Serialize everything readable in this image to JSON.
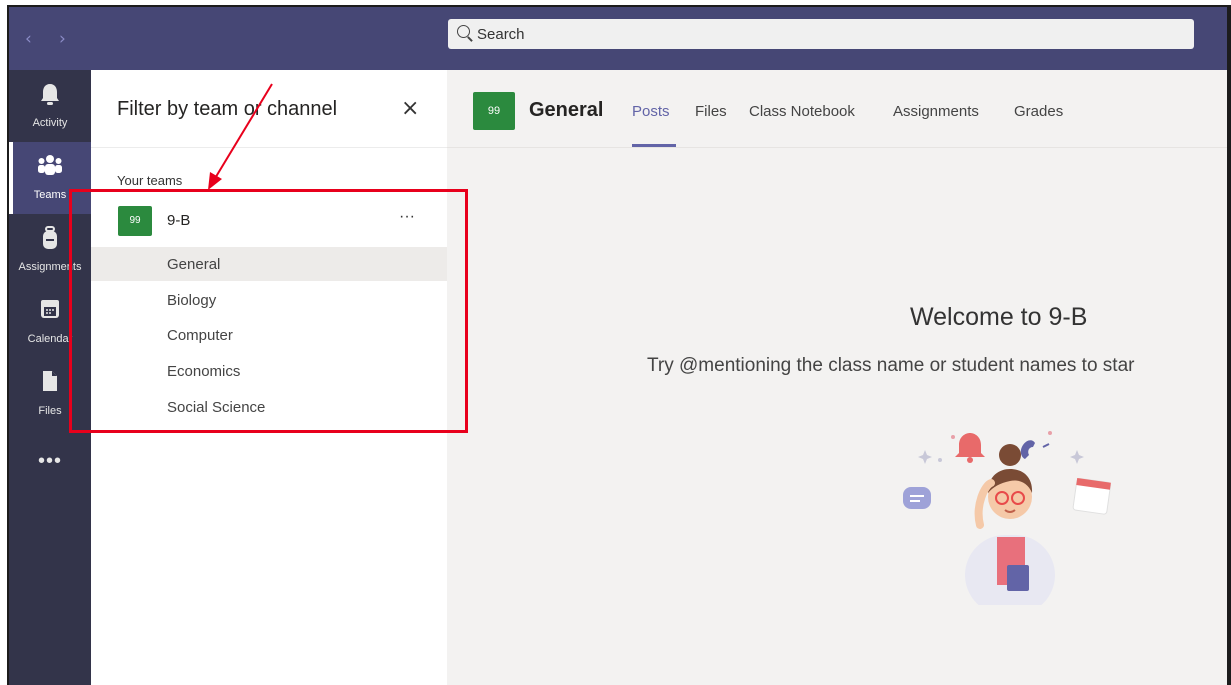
{
  "topbar": {
    "back_glyph": "‹",
    "forward_glyph": "›",
    "search_placeholder": "Search"
  },
  "rail": {
    "items": [
      {
        "label": "Activity",
        "icon": "bell-icon"
      },
      {
        "label": "Teams",
        "icon": "people-icon",
        "active": true
      },
      {
        "label": "Assignments",
        "icon": "backpack-icon"
      },
      {
        "label": "Calendar",
        "icon": "calendar-icon"
      },
      {
        "label": "Files",
        "icon": "file-icon"
      }
    ],
    "more": "•••"
  },
  "panel": {
    "filter_title": "Filter by team or channel",
    "close_glyph": "×",
    "section_label": "Your teams",
    "team": {
      "avatar": "99",
      "name": "9-B",
      "more": "···"
    },
    "channels": [
      "General",
      "Biology",
      "Computer",
      "Economics",
      "Social Science"
    ],
    "selected_channel": "General"
  },
  "main": {
    "avatar": "99",
    "channel_title": "General",
    "tabs": [
      "Posts",
      "Files",
      "Class Notebook",
      "Assignments",
      "Grades"
    ],
    "active_tab": "Posts",
    "welcome_title": "Welcome to 9-B",
    "welcome_sub": "Try @mentioning the class name or student names to star"
  },
  "colors": {
    "topbar": "#464775",
    "rail": "#33344a",
    "accent": "#6264a7",
    "team_avatar": "#2b8a3e",
    "annotation": "#e8001c"
  }
}
